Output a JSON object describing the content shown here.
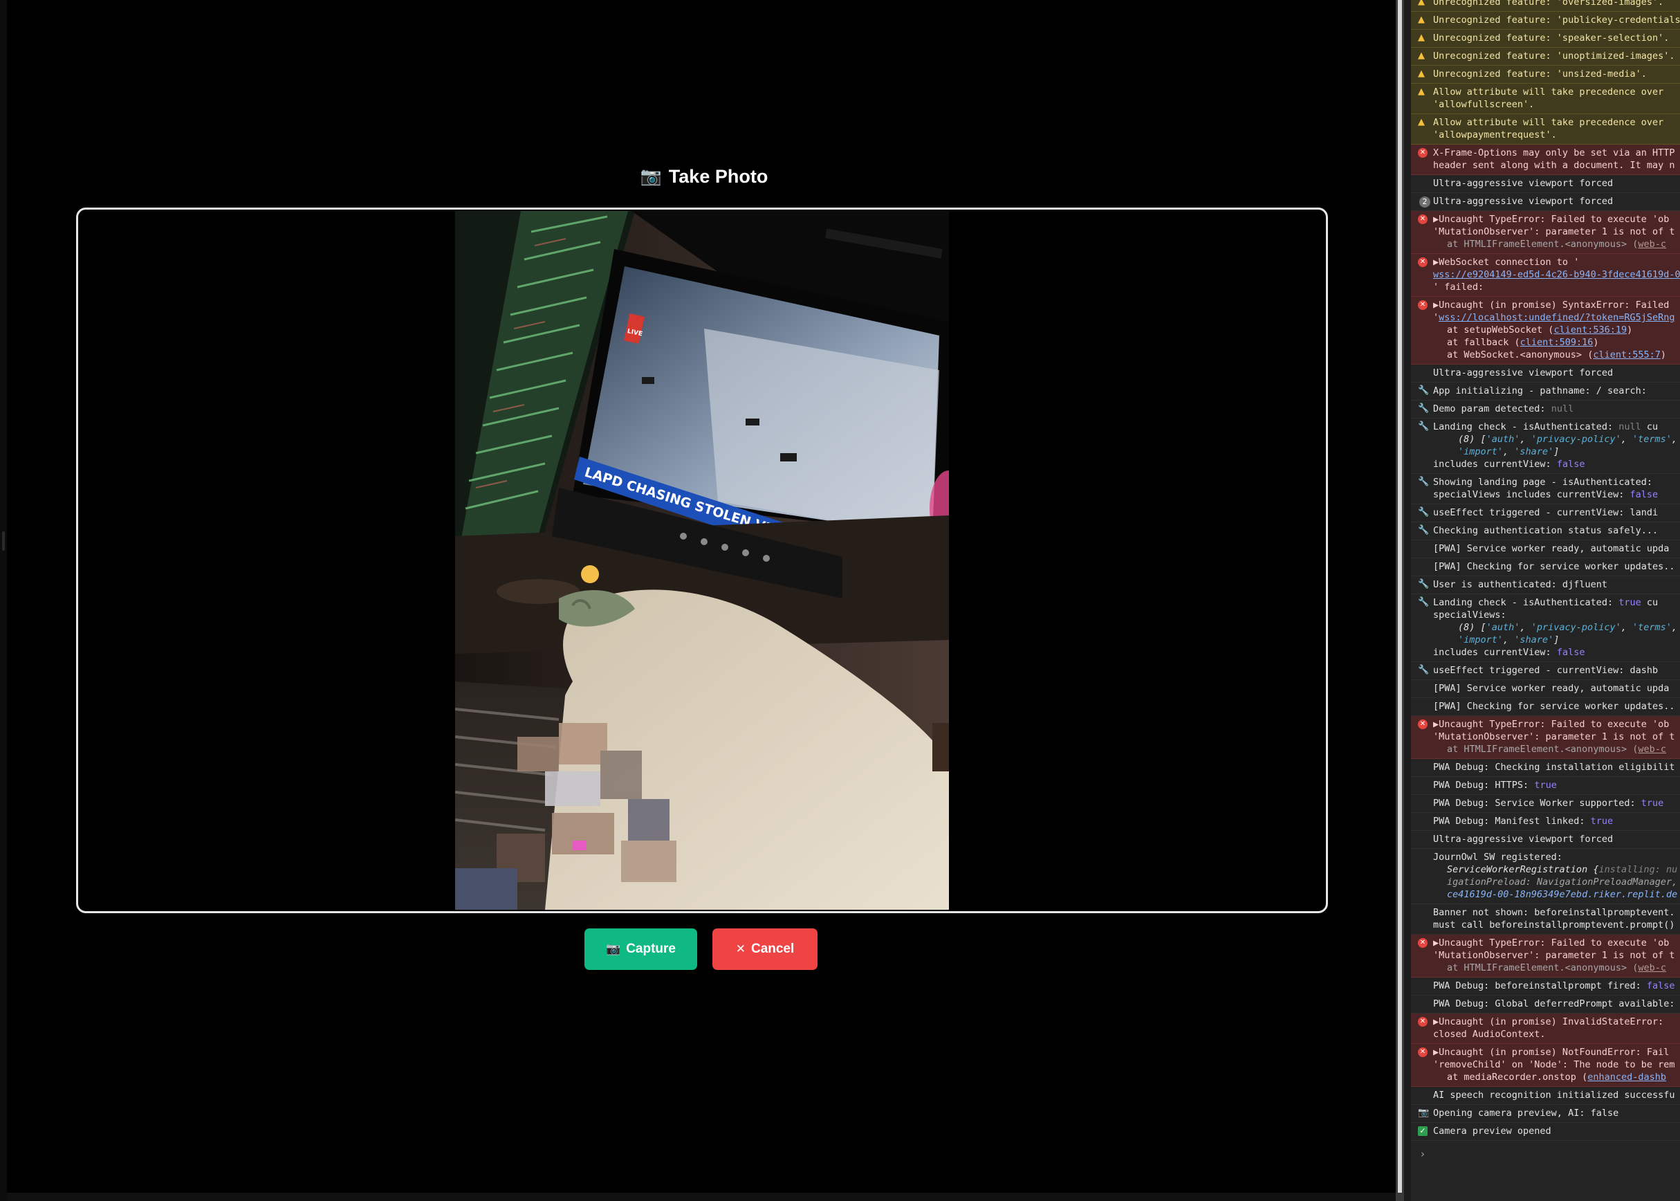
{
  "modal": {
    "title": "Take Photo",
    "title_icon": "📷",
    "capture_label": "Capture",
    "capture_icon": "📷",
    "cancel_label": "Cancel",
    "cancel_icon": "✕",
    "tv_ticker": "LAPD CHASING STOLEN VEHICLE SUSPECT",
    "tv_live_badge": "LIVE"
  },
  "console": {
    "w1": "Unrecognized feature: 'oversized-images'.",
    "w2": "Unrecognized feature: 'publickey-credentials",
    "w3": "Unrecognized feature: 'speaker-selection'.",
    "w4": "Unrecognized feature: 'unoptimized-images'.",
    "w5": "Unrecognized feature: 'unsized-media'.",
    "w6a": "Allow attribute will take precedence over",
    "w6b": "'allowfullscreen'.",
    "w7a": "Allow attribute will take precedence over",
    "w7b": "'allowpaymentrequest'.",
    "e1a": "X-Frame-Options may only be set via an HTTP",
    "e1b": "header sent along with a document. It may n",
    "i1": "Ultra-aggressive viewport forced",
    "i2_count": "2",
    "i2": "Ultra-aggressive viewport forced",
    "e2a": "▶Uncaught TypeError: Failed to execute 'ob",
    "e2b": "'MutationObserver': parameter 1 is not of t",
    "e2c": "at HTMLIFrameElement.<anonymous> (",
    "e2c_link": "web-c",
    "e3a": "▶WebSocket connection to '",
    "e3b_link": "wss://e9204149-ed5d-4c26-b940-3fdece41619d-0",
    "e3c": "' failed:",
    "e4a": "▶Uncaught (in promise) SyntaxError: Failed",
    "e4b_pre": "'",
    "e4b_link": "wss://localhost:undefined/?token=RG5jSeRng",
    "e4c_pre": "at setupWebSocket (",
    "e4c_link": "client:536:19",
    "e4c_post": ")",
    "e4d_pre": "at fallback (",
    "e4d_link": "client:509:16",
    "e4d_post": ")",
    "e4e_pre": "at WebSocket.<anonymous> (",
    "e4e_link": "client:555:7",
    "e4e_post": ")",
    "i3": "Ultra-aggressive viewport forced",
    "i4": "App initializing - pathname: / search:",
    "i5_pre": "Demo param detected: ",
    "i5_val": "null",
    "i6_pre": "Landing check - isAuthenticated: ",
    "i6_val": "null",
    "i6_post": " cu",
    "i6_arr_pre": "(8) [",
    "i6_arr_s1": "'auth'",
    "i6_arr_s2": "'privacy-policy'",
    "i6_arr_s3": "'terms'",
    "i6_arr_s4": "'import'",
    "i6_arr_s5": "'share'",
    "i6_arr_post": "]",
    "i6_inc": "includes currentView: ",
    "i6_inc_val": "false",
    "i7a": "Showing landing page - isAuthenticated:",
    "i7b": "specialViews includes currentView: ",
    "i7b_val": "false",
    "i8": "useEffect triggered - currentView: landi",
    "i9": "Checking authentication status safely...",
    "i10": "[PWA] Service worker ready, automatic upda",
    "i11": "[PWA] Checking for service worker updates..",
    "i12": "User is authenticated: djfluent",
    "i13_pre": "Landing check - isAuthenticated: ",
    "i13_val": "true",
    "i13_post": " cu",
    "i13_sv": "specialViews:",
    "i13_inc": "includes currentView: ",
    "i13_inc_val": "false",
    "i14": "useEffect triggered - currentView: dashb",
    "i15": "[PWA] Service worker ready, automatic upda",
    "i16": "[PWA] Checking for service worker updates..",
    "e5a": "▶Uncaught TypeError: Failed to execute 'ob",
    "e5b": "'MutationObserver': parameter 1 is not of t",
    "e5c": "at HTMLIFrameElement.<anonymous> (",
    "e5c_link": "web-c",
    "i17": "PWA Debug: Checking installation eligibilit",
    "i18_pre": "PWA Debug: HTTPS: ",
    "i18_val": "true",
    "i19_pre": "PWA Debug: Service Worker supported: ",
    "i19_val": "true",
    "i20_pre": "PWA Debug: Manifest linked: ",
    "i20_val": "true",
    "i21": "Ultra-aggressive viewport forced",
    "i22a": "JournOwl SW registered:",
    "i22b_pre": "ServiceWorkerRegistration {",
    "i22b_val": "installing: nu",
    "i22c_pre": "igationPreload: ",
    "i22c_val": "NavigationPreloadManager,",
    "i22d": "ce41619d-00-18n96349e7ebd.riker.replit.de",
    "i23a": "Banner not shown: beforeinstallpromptevent.",
    "i23b": "must call beforeinstallpromptevent.prompt()",
    "e6a": "▶Uncaught TypeError: Failed to execute 'ob",
    "e6b": "'MutationObserver': parameter 1 is not of t",
    "e6c": "at HTMLIFrameElement.<anonymous> (",
    "e6c_link": "web-c",
    "i24_pre": "PWA Debug: beforeinstallprompt fired: ",
    "i24_val": "false",
    "i25": "PWA Debug: Global deferredPrompt available:",
    "e7a": "▶Uncaught (in promise) InvalidStateError:",
    "e7b": "closed AudioContext.",
    "e8a": "▶Uncaught (in promise) NotFoundError: Fail",
    "e8b": "'removeChild' on 'Node': The node to be rem",
    "e8c": "at mediaRecorder.onstop (",
    "e8c_link": "enhanced-dashb",
    "i26": "AI speech recognition initialized successfu",
    "i27": "Opening camera preview, AI: false",
    "i28": "Camera preview opened",
    "prompt": "›"
  }
}
